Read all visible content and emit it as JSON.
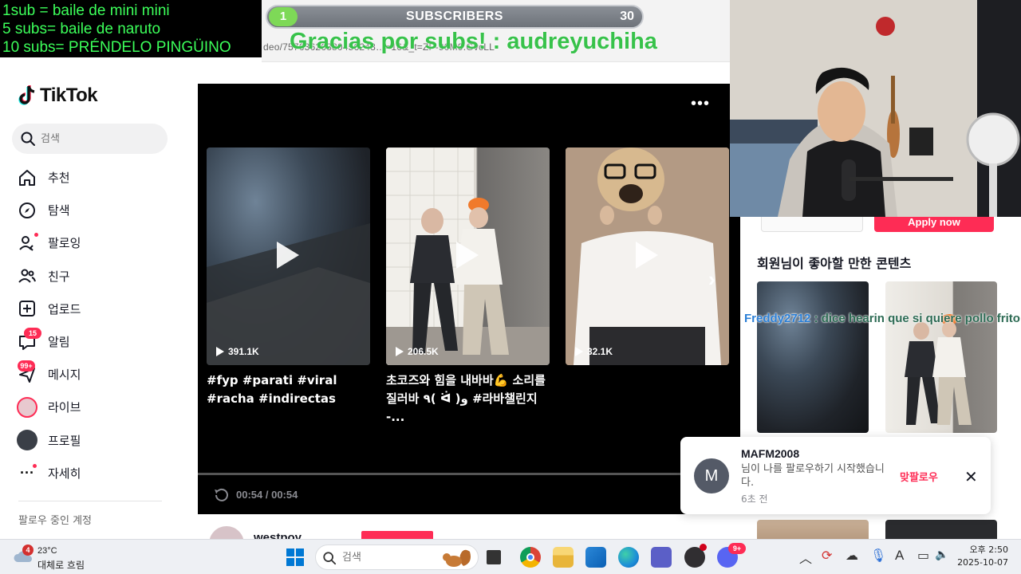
{
  "overlay": {
    "rules": [
      "1sub = baile de mini mini",
      "5 subs= baile de naruto",
      "10 subs= PRÉNDELO PINGÜINO"
    ],
    "subscribers": {
      "current": "1",
      "label": "SUBSCRIBERS",
      "goal": "30"
    },
    "thanks": "Gracias por subs! : audreyuchiha",
    "chat": {
      "user": "Freddy2712",
      "message": ": dice hearin que si quiere pollo frito"
    }
  },
  "browser": {
    "url_fragment": "deo/75763626380456248…=16&_t=ZP-90M9.GvcLL"
  },
  "sidebar": {
    "logo": "TikTok",
    "search_placeholder": "검색",
    "items": [
      {
        "label": "추천",
        "icon": "home-icon"
      },
      {
        "label": "탐색",
        "icon": "compass-icon"
      },
      {
        "label": "팔로잉",
        "icon": "following-icon"
      },
      {
        "label": "친구",
        "icon": "friends-icon"
      },
      {
        "label": "업로드",
        "icon": "upload-icon"
      },
      {
        "label": "알림",
        "icon": "inbox-icon",
        "badge": "15"
      },
      {
        "label": "메시지",
        "icon": "message-icon",
        "badge": "99+"
      },
      {
        "label": "라이브",
        "icon": "live-avatar-icon"
      },
      {
        "label": "프로필",
        "icon": "profile-avatar-icon"
      },
      {
        "label": "자세히",
        "icon": "more-icon"
      }
    ],
    "following_title": "팔로우 중인 계정"
  },
  "player": {
    "videos": [
      {
        "views": "391.1K",
        "caption": "#fyp #parati #viral #racha #indirectas"
      },
      {
        "views": "206.5K",
        "caption": "초코즈와 힘을 내바바💪 소리를 질러바 ٩( ᐛ )و #라바챌린지 -..."
      },
      {
        "views": "32.1K",
        "caption": ""
      }
    ],
    "time": "00:54 / 00:54",
    "progress": 1.0,
    "author": "westpoy"
  },
  "right": {
    "apply_button": "Apply now",
    "recommend_title": "회원님이 좋아할 만한 콘텐츠"
  },
  "notification": {
    "avatar_letter": "M",
    "user": "MAFM2008",
    "text": "님이 나를 팔로우하기 시작했습니다.",
    "ago": "6초 전",
    "follow_back": "맞팔로우"
  },
  "taskbar": {
    "weather_badge": "4",
    "temperature": "23°C",
    "condition": "대체로 흐림",
    "search_placeholder": "검색",
    "time": "오후 2:50",
    "date": "2025-10-07",
    "discord_badge": "9+"
  }
}
